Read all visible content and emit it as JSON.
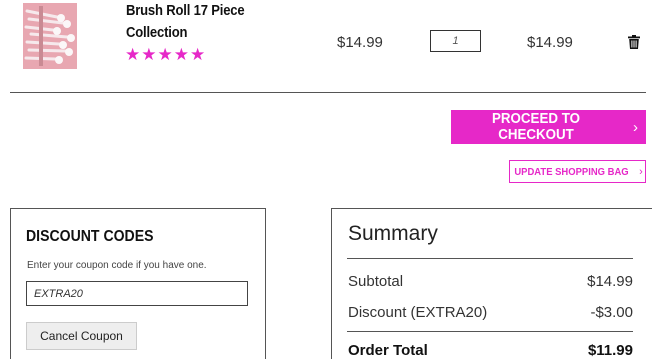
{
  "cart_item": {
    "name": "Brush Roll 17 Piece Collection",
    "rating_stars": "★★★★★",
    "rating": 5,
    "unit_price": "$14.99",
    "quantity": "1",
    "line_total": "$14.99",
    "remove_icon": "trash-icon"
  },
  "actions": {
    "checkout_label": "PROCEED TO CHECKOUT",
    "checkout_chevron": "›",
    "update_label": "UPDATE SHOPPING BAG",
    "update_chevron": "›"
  },
  "discount": {
    "title": "DISCOUNT CODES",
    "hint": "Enter your coupon code if you have one.",
    "coupon_value": "EXTRA20",
    "cancel_label": "Cancel Coupon"
  },
  "summary": {
    "title": "Summary",
    "subtotal_label": "Subtotal",
    "subtotal_value": "$14.99",
    "discount_label": "Discount (EXTRA20)",
    "discount_value": "-$3.00",
    "order_total_label": "Order Total",
    "order_total_value": "$11.99"
  },
  "colors": {
    "accent": "#e628c8",
    "thumb_bg": "#e8a7b1"
  }
}
